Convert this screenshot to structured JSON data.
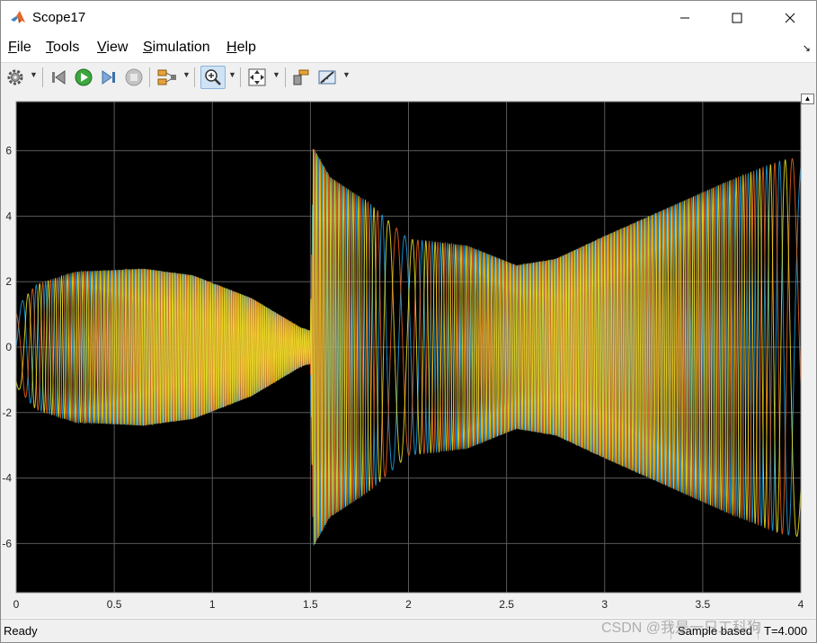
{
  "window": {
    "title": "Scope17"
  },
  "menu": [
    {
      "label": "File",
      "underline": "F",
      "rest": "ile"
    },
    {
      "label": "Tools",
      "underline": "T",
      "rest": "ools"
    },
    {
      "label": "View",
      "underline": "V",
      "rest": "iew"
    },
    {
      "label": "Simulation",
      "underline": "S",
      "rest": "imulation"
    },
    {
      "label": "Help",
      "underline": "H",
      "rest": "elp"
    }
  ],
  "toolbar": {
    "icons": [
      "settings-icon",
      "step-back-icon",
      "run-icon",
      "step-forward-icon",
      "stop-icon",
      "signal-selector-icon",
      "zoom-in-icon",
      "fit-to-view-icon",
      "highlight-block-icon",
      "measurements-icon"
    ]
  },
  "statusbar": {
    "status": "Ready",
    "mode": "Sample based",
    "time": "T=4.000"
  },
  "watermark": "CSDN @我是一只工科狗",
  "colors": {
    "plot_background": "#000000",
    "grid": "#5a5a5a",
    "series1": "#0072bd",
    "series2": "#d95319",
    "series3": "#edb120"
  },
  "chart_data": {
    "type": "line",
    "xlim": [
      0,
      4
    ],
    "ylim": [
      -7.5,
      7.5
    ],
    "xticks": [
      0,
      0.5,
      1,
      1.5,
      2,
      2.5,
      3,
      3.5,
      4
    ],
    "xtick_labels": [
      "0",
      "0.5",
      "1",
      "1.5",
      "2",
      "2.5",
      "3",
      "3.5",
      "4"
    ],
    "yticks": [
      -6,
      -4,
      -2,
      0,
      2,
      4,
      6
    ],
    "ytick_labels": [
      "-6",
      "-4",
      "-2",
      "0",
      "2",
      "4",
      "6"
    ],
    "grid": true,
    "series": [
      {
        "color": "#1fa3e8",
        "phase_deg": 0
      },
      {
        "color": "#f0641e",
        "phase_deg": 120
      },
      {
        "color": "#f2e81e",
        "phase_deg": 240
      }
    ],
    "envelope": [
      [
        0,
        1.2
      ],
      [
        0.1,
        1.9
      ],
      [
        0.3,
        2.3
      ],
      [
        0.65,
        2.4
      ],
      [
        0.9,
        2.2
      ],
      [
        1.2,
        1.5
      ],
      [
        1.45,
        0.6
      ],
      [
        1.5,
        0.5
      ],
      [
        1.515,
        6.1
      ],
      [
        1.6,
        5.2
      ],
      [
        1.8,
        4.4
      ],
      [
        2.0,
        3.3
      ],
      [
        2.3,
        3.1
      ],
      [
        2.55,
        2.5
      ],
      [
        2.75,
        2.7
      ],
      [
        3.0,
        3.4
      ],
      [
        3.3,
        4.2
      ],
      [
        3.6,
        5.0
      ],
      [
        3.9,
        5.7
      ],
      [
        4.0,
        5.8
      ]
    ],
    "frequency_hz": [
      [
        0,
        6
      ],
      [
        0.2,
        30
      ],
      [
        0.7,
        70
      ],
      [
        1.2,
        90
      ],
      [
        1.5,
        95
      ],
      [
        1.52,
        60
      ],
      [
        1.7,
        40
      ],
      [
        1.85,
        15
      ],
      [
        1.9,
        8
      ],
      [
        2.0,
        8
      ],
      [
        2.1,
        20
      ],
      [
        2.4,
        50
      ],
      [
        2.8,
        70
      ],
      [
        3.2,
        55
      ],
      [
        3.6,
        35
      ],
      [
        3.9,
        12
      ],
      [
        4.0,
        5
      ]
    ]
  }
}
